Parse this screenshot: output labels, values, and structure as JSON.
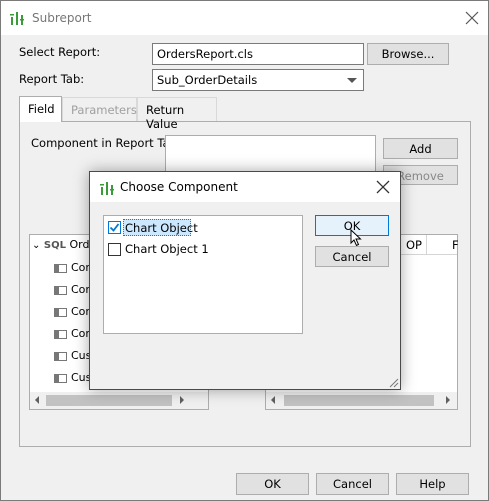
{
  "window": {
    "title": "Subreport",
    "icon": "report-bars-icon"
  },
  "form": {
    "select_report_label": "Select Report:",
    "select_report_value": "OrdersReport.cls",
    "browse_label": "Browse...",
    "report_tab_label": "Report Tab:",
    "report_tab_value": "Sub_OrderDetails"
  },
  "tabs": [
    {
      "label": "Field",
      "state": "active"
    },
    {
      "label": "Parameters",
      "state": "disabled"
    },
    {
      "label": "Return Value",
      "state": "normal"
    }
  ],
  "field_panel": {
    "component_label": "Component in Report Tab:",
    "add_label": "Add",
    "remove_label": "Remove",
    "tree_root": "Order",
    "tree_root_icon": "SQL",
    "tree_items": [
      "Cor",
      "Cor",
      "Cor",
      "Cor",
      "Cus",
      "Cus"
    ],
    "right_table_headers": [
      "OP",
      "F"
    ]
  },
  "footer": {
    "ok": "OK",
    "cancel": "Cancel",
    "help": "Help"
  },
  "dialog": {
    "title": "Choose Component",
    "items": [
      {
        "label": "Chart Object",
        "checked": true,
        "selected": true
      },
      {
        "label": "Chart Object 1",
        "checked": false,
        "selected": false
      }
    ],
    "ok": "OK",
    "cancel": "Cancel"
  },
  "colors": {
    "accent": "#0078d7",
    "selection": "#cce8ff",
    "icon_green": "#3a9b3a"
  }
}
